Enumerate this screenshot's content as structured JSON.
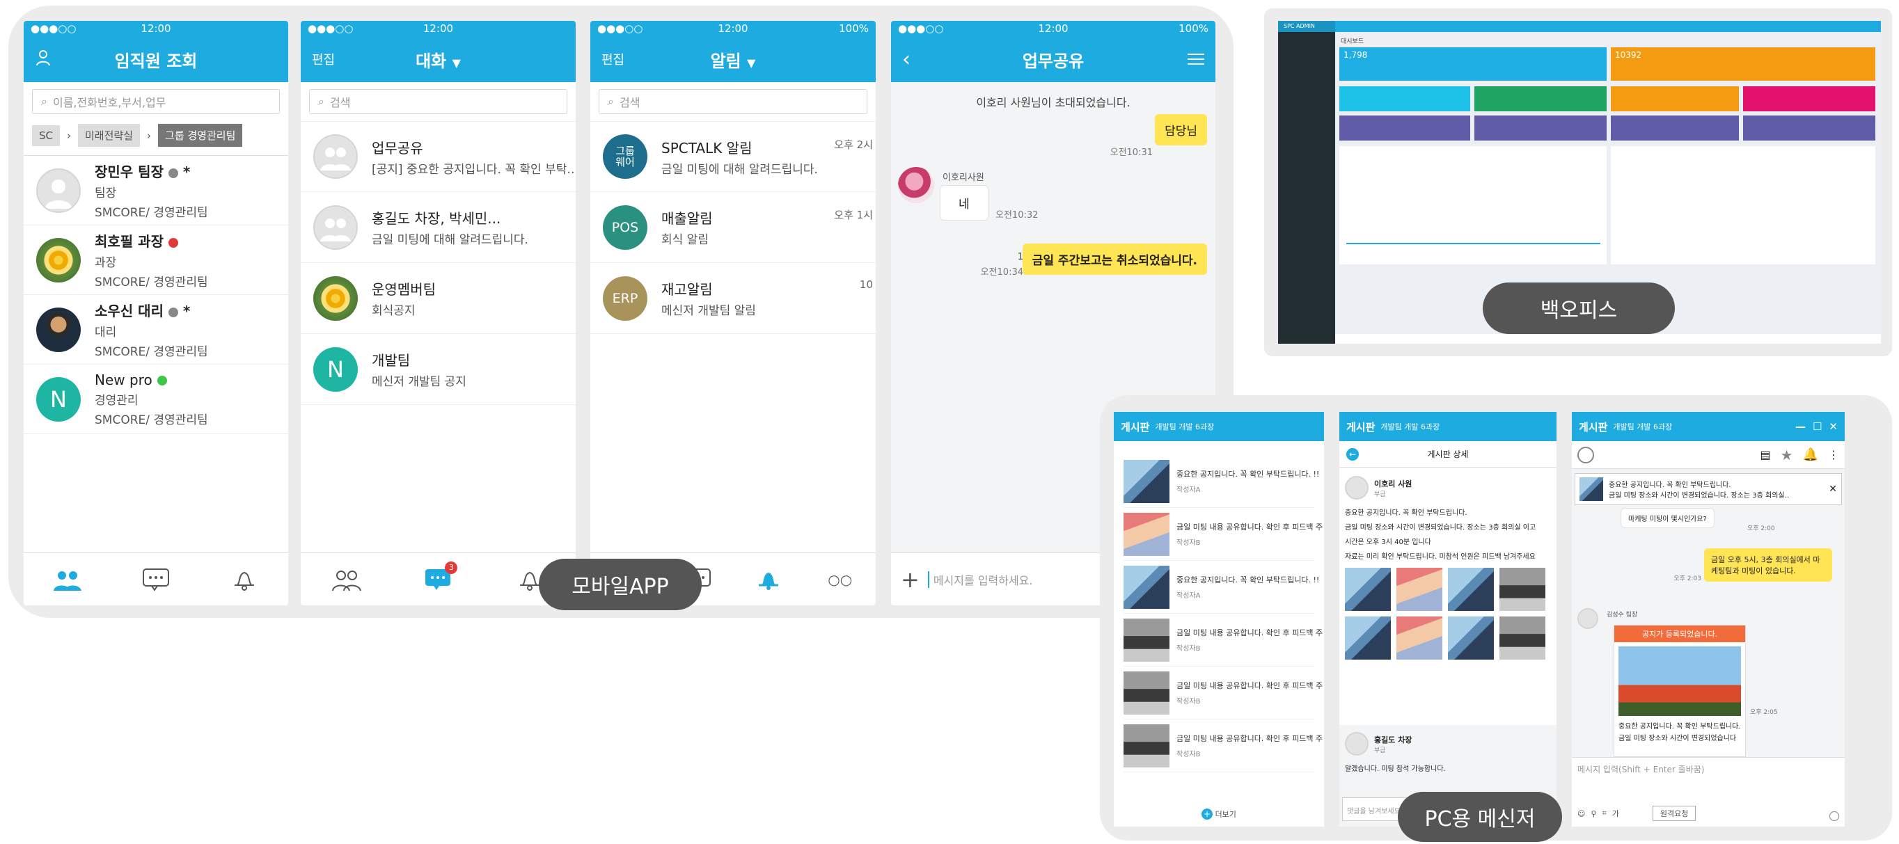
{
  "phone1": {
    "status": {
      "time": "12:00",
      "signal": "●●●○○"
    },
    "title": "임직원 조회",
    "search_placeholder": "이름,전화번호,부서,업무",
    "breadcrumb": [
      "SC",
      "미래전략실",
      "그룹 경영관리팀"
    ],
    "contacts": [
      {
        "name": "장민우 팀장",
        "role": "팀장",
        "dept": "SMCORE/ 경영관리팀",
        "status_color": "#888888",
        "star": "*"
      },
      {
        "name": "최호필 과장",
        "role": "과장",
        "dept": "SMCORE/ 경영관리팀",
        "status_color": "#e03a3a",
        "star": ""
      },
      {
        "name": "소우신 대리",
        "role": "대리",
        "dept": "SMCORE/ 경영관리팀",
        "status_color": "#888888",
        "star": "*"
      },
      {
        "name": "New pro",
        "role": "경영관리",
        "dept": "SMCORE/ 경영관리팀",
        "status_color": "#3cc64a",
        "star": "",
        "initial": "N"
      }
    ]
  },
  "phone2": {
    "status": {
      "time": "12:00"
    },
    "edit": "편집",
    "title": "대화",
    "search_placeholder": "검색",
    "chats": [
      {
        "name": "업무공유",
        "preview": "[공지] 중요한 공지입니다. 꼭 확인 부탁…"
      },
      {
        "name": "홍길도 차장, 박세민...",
        "preview": "금일 미팅에 대해 알려드립니다."
      },
      {
        "name": "운영멤버팀",
        "preview": "회식공지"
      },
      {
        "name": "개발팀",
        "preview": "메신저 개발팀 공지",
        "initial": "N"
      }
    ],
    "badge": "3"
  },
  "phone3": {
    "status": {
      "time": "12:00",
      "battery": "100%"
    },
    "edit": "편집",
    "title": "알림",
    "search_placeholder": "검색",
    "alerts": [
      {
        "avatar": "그룹\n웨어",
        "name": "SPCTALK 알림",
        "preview": "금일 미팅에 대해 알려드립니다.",
        "time": "오후 2시",
        "color": "#1c6e8c"
      },
      {
        "avatar": "POS",
        "name": "매출알림",
        "preview": "회식 알림",
        "time": "오후 1시",
        "color": "#2a9080"
      },
      {
        "avatar": "ERP",
        "name": "재고알림",
        "preview": "메신저 개발팀 알림",
        "time": "10",
        "color": "#a8935a"
      }
    ]
  },
  "phone4": {
    "status": {
      "time": "12:00",
      "battery": "100%"
    },
    "title": "업무공유",
    "system_msg": "이호리 사원님이 초대되었습니다.",
    "messages": [
      {
        "text": "담당님",
        "time": "오전10:31"
      },
      {
        "sender": "이호리사원",
        "text": "네",
        "time": "오전10:32"
      },
      {
        "text": "금일 주간보고는 취소되었습니다.",
        "time": "오전10:34",
        "read": "1"
      }
    ],
    "input_placeholder": "메시지를 입력하세요."
  },
  "labels": {
    "mobile": "모바일APP",
    "backoffice": "백오피스",
    "pc": "PC용 메신저"
  },
  "admin": {
    "brand": "SPC ADMIN",
    "page_title": "대시보드",
    "stat1": "1,798",
    "stat2": "10392",
    "colors": {
      "blue": "#1eaee3",
      "orange": "#f39c12",
      "cyan": "#1cc2e8",
      "green": "#1fa463",
      "pink": "#e3126e",
      "purple": "#605ca8"
    }
  },
  "pc1": {
    "title": "게시판",
    "subtitle": "개발팀 개발 6과장",
    "posts": [
      {
        "text": "중요한 공지입니다. 꼭 확인 부탁드립니다. !!",
        "author": "작성자A"
      },
      {
        "text": "금일 미팅 내용 공유합니다. 확인 후 피드백 주",
        "author": "작성자B"
      },
      {
        "text": "중요한 공지입니다. 꼭 확인 부탁드립니다. !!",
        "author": "작성자A"
      },
      {
        "text": "금일 미팅 내용 공유합니다. 확인 후 피드백 주",
        "author": "작성자B"
      },
      {
        "text": "금일 미팅 내용 공유합니다. 확인 후 피드백 주",
        "author": "작성자B"
      },
      {
        "text": "금일 미팅 내용 공유합니다. 확인 후 피드백 주",
        "author": "작성자B"
      }
    ],
    "more": "더보기"
  },
  "pc2": {
    "title": "게시판",
    "subtitle": "개발팀 개발 6과장",
    "detail": "게시판 상세",
    "author": "이호리 사원",
    "author_role": "부급",
    "body": [
      "중요한 공지입니다. 꼭 확인 부탁드립니다.",
      "금일 미팅 장소와 시간이 변경되었습니다. 장소는 3층 회의실 이고",
      "시간은 오후 3시 40분 입니다",
      "자료는 미리 확인 부탁드립니다. 미참석 인원은 피드백 남겨주세요"
    ],
    "commenter": "홍길도 차장",
    "commenter_role": "부급",
    "comment": "알겠습니다. 미팅 참석 가능합니다.",
    "comment_placeholder": "댓글을 남겨보세요"
  },
  "pc3": {
    "title": "게시판",
    "subtitle": "개발팀 개발 6과장",
    "notice_line1": "중요한 공지입니다. 꼭 확인 부탁드립니다.",
    "notice_line2": "금일 미팅 장소와 시간이 변경되었습니다. 장소는 3층 회의실…",
    "msg1": "마케팅 미팅이 몇시인가요?",
    "msg1_time": "오후 2:00",
    "msg2": "금일 오후 5시, 3층 회의실에서 마케팅팀과 미팅이 있습니다.",
    "msg2_time": "오후 2:03",
    "sender": "김성수 팀장",
    "card_title": "공지가 등록되었습니다.",
    "card_text": "중요한 공지입니다. 꼭 확인 부탁드립니다.",
    "card_text2": "금일 미팅 장소와 시간이 변경되었습니다",
    "card_time": "오후 2:05",
    "input_placeholder": "메시지 입력(Shift + Enter 줄바꿈)",
    "toolbar_btn": "원격요청"
  }
}
